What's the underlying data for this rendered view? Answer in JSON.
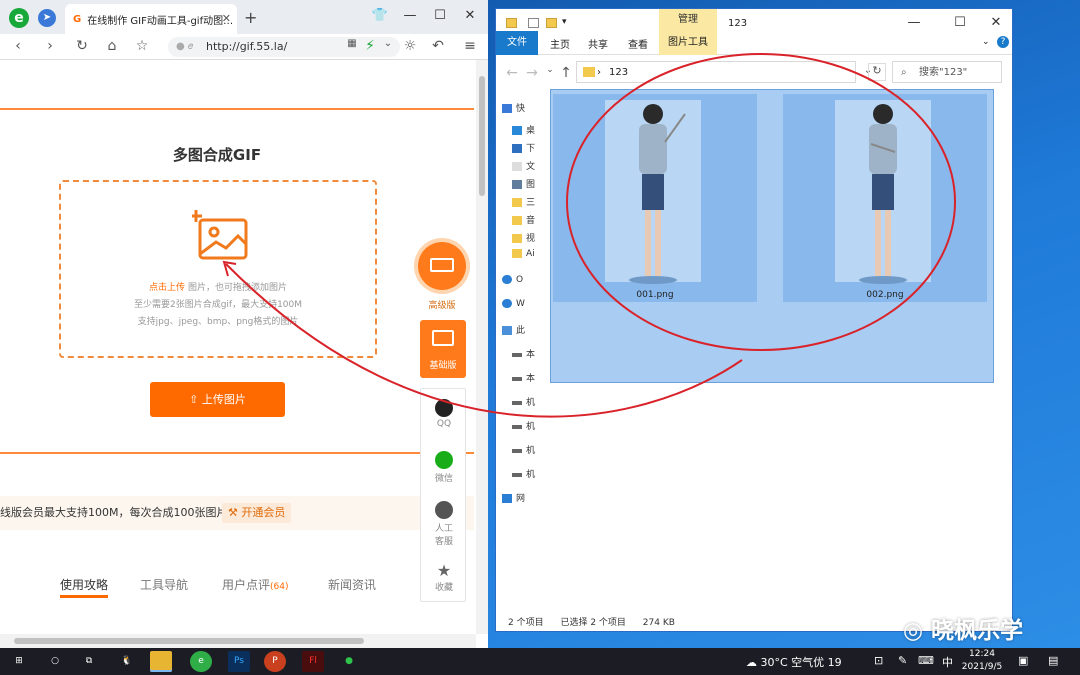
{
  "browser": {
    "tab_title": "在线制作 GIF动画工具-gif动图…",
    "tab_favicon": "G",
    "ie_icon": "e",
    "address": "http://gif.55.la/",
    "win_min": "—",
    "win_max": "☐",
    "win_close": "✕",
    "newtab": "+"
  },
  "page": {
    "title": "多图合成GIF",
    "dz_line1_link": "点击上传",
    "dz_line1_rest": "图片，也可拖拽添加图片",
    "dz_line2": "至少需要2张图片合成gif，最大支持100M",
    "dz_line3": "支持jpg、jpeg、bmp、png格式的图片",
    "upload_btn": "上传图片",
    "vip_text": "线版会员最大支持100M，每次合成100张图片。",
    "vip_link": "开通会员",
    "bottom_tabs": [
      "使用攻略",
      "工具导航",
      "用户点评",
      "新闻资讯"
    ],
    "review_count": "(64)",
    "side_adv": "高级版",
    "side_basic": "基础版",
    "side_qq": "QQ",
    "side_wechat": "微信",
    "side_service": "人工客服",
    "side_fav": "收藏"
  },
  "explorer": {
    "title": "123",
    "manage_tab": "管理",
    "ribbon_tabs": [
      "文件",
      "主页",
      "共享",
      "查看",
      "图片工具"
    ],
    "path": "123",
    "search_placeholder": "搜索\"123\"",
    "side_items": [
      "快",
      "桌",
      "下",
      "文",
      "图",
      "三",
      "音",
      "视",
      "Ai",
      "O",
      "W",
      "此",
      "本",
      "本",
      "机",
      "机",
      "机",
      "机",
      "网"
    ],
    "files": [
      "001.png",
      "002.png"
    ],
    "status_count": "2 个项目",
    "status_selected": "已选择 2 个项目",
    "status_size": "274 KB"
  },
  "watermark": "晓枫乐学",
  "taskbar": {
    "weather": "30°C  空气优 19",
    "ime": "中",
    "time": "12:24",
    "date": "2021/9/5"
  },
  "colors": {
    "accent_orange": "#ff6a00",
    "annotation_red": "#d9232a",
    "explorer_select": "#a9cdf2"
  }
}
